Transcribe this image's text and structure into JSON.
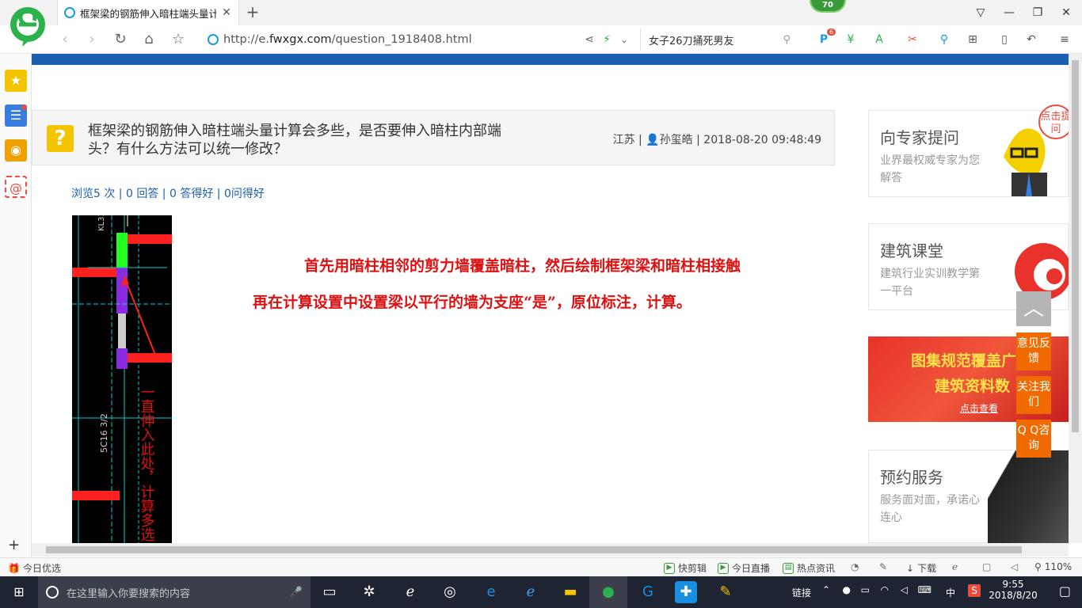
{
  "browser": {
    "tab_title": "框架梁的钢筋伸入暗柱端头量计算",
    "new_tab_icon": "+",
    "shield_badge": "70",
    "url_prefix": "http://e.",
    "url_domain": "fwxgx.com",
    "url_path": "/question_1918408.html",
    "search_text": "女子26刀捅死男友",
    "ext_badge": "6"
  },
  "sidebar": {
    "items": [
      {
        "icon": "star-icon",
        "color": "#f5c400"
      },
      {
        "icon": "list-icon",
        "color": "#3a7de0"
      },
      {
        "icon": "weibo-icon",
        "color": "#f0a000"
      },
      {
        "icon": "mail-icon",
        "color": "#e84c3d"
      }
    ],
    "add_label": "+"
  },
  "question": {
    "title_line1": "框架梁的钢筋伸入暗柱端头量计算会多些，是否要伸入暗柱内部端",
    "title_line2": "头？有什么方法可以统一修改？",
    "region": "江苏",
    "author": "孙玺皓",
    "datetime": "2018-08-20 09:48:49",
    "views": "浏览5 次",
    "answers": "0 回答",
    "good_answers": "0 答得好",
    "good_questions": "0问得好"
  },
  "answer": {
    "line1": "首先用暗柱相邻的剪力墙覆盖暗柱，然后绘制框架梁和暗柱相接触",
    "line2": "再在计算设置中设置梁以平行的墙为支座“是”，原位标注，计算。"
  },
  "cad_image": {
    "annotation": "一直伸入此处，计算多选"
  },
  "right_cards": [
    {
      "title": "向专家提问",
      "subtitle": "业界最权威专家为您解答",
      "bubble": "点击提问"
    },
    {
      "title": "建筑课堂",
      "subtitle": "建筑行业实训教学第一平台"
    },
    {
      "title": "预约服务",
      "subtitle": "服务面对面，承诺心连心"
    }
  ],
  "banner": {
    "line1": "图集规范覆盖广",
    "line2": "建筑资料数",
    "link": "点击查看"
  },
  "floating": {
    "feedback": "意见反馈",
    "follow": "关注我们",
    "qq": "Q Q咨询"
  },
  "statusbar": {
    "left": "今日优选",
    "items": [
      "快剪辑",
      "今日直播",
      "热点资讯"
    ],
    "download": "下载",
    "zoom": "110%"
  },
  "taskbar": {
    "search_placeholder": "在这里输入你要搜索的内容",
    "link_label": "链接",
    "ime": "中",
    "time": "9:55",
    "date": "2018/8/20"
  }
}
